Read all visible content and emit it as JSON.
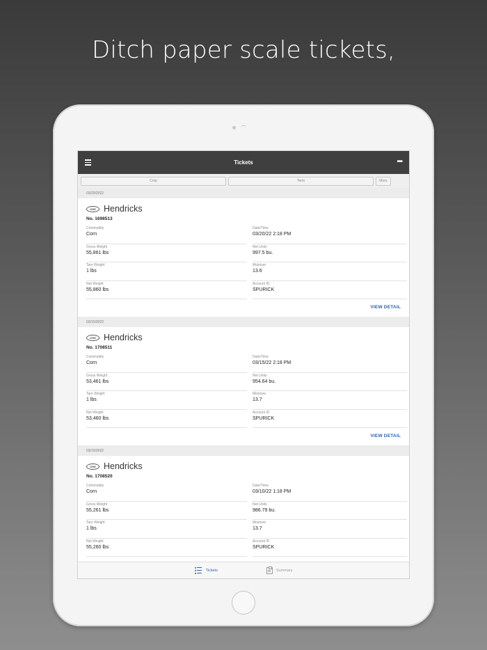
{
  "headline": "Ditch paper scale tickets,",
  "app": {
    "title": "Tickets",
    "more_label": "•••"
  },
  "filters": {
    "crop": "Crop",
    "term": "Term",
    "more": "More"
  },
  "labels": {
    "commodity": "Commodity",
    "datetime": "Date/Time",
    "gross_weight": "Gross Weight",
    "net_units": "Net Units",
    "tare_weight": "Tare Weight",
    "moisture": "Moisture",
    "net_weight": "Net Weight",
    "account_id": "Account ID",
    "view_detail": "VIEW DETAIL"
  },
  "tickets": [
    {
      "date": "03/20/2022",
      "logo": "CHS",
      "location": "Hendricks",
      "number": "No. 1698513",
      "commodity": "Corn",
      "datetime": "03/20/22 2:18 PM",
      "gross_weight": "55,861 lbs",
      "net_units": "997.5 bu.",
      "tare_weight": "1 lbs",
      "moisture": "13.6",
      "net_weight": "55,860 lbs",
      "account_id": "SPURICK"
    },
    {
      "date": "03/15/2022",
      "logo": "CHS",
      "location": "Hendricks",
      "number": "No. 1708511",
      "commodity": "Corn",
      "datetime": "03/15/22 2:18 PM",
      "gross_weight": "53,461 lbs",
      "net_units": "954.64 bu.",
      "tare_weight": "1 lbs",
      "moisture": "13.7",
      "net_weight": "53,460 lbs",
      "account_id": "SPURICK"
    },
    {
      "date": "03/10/2022",
      "logo": "CHS",
      "location": "Hendricks",
      "number": "No. 1708520",
      "commodity": "Corn",
      "datetime": "03/10/22 1:18 PM",
      "gross_weight": "55,261 lbs",
      "net_units": "986.79 bu.",
      "tare_weight": "1 lbs",
      "moisture": "13.7",
      "net_weight": "55,260 lbs",
      "account_id": "SPURICK"
    }
  ],
  "tabs": [
    {
      "label": "Tickets",
      "icon": "list-icon",
      "active": true
    },
    {
      "label": "Summary",
      "icon": "clipboard-icon",
      "active": false
    }
  ],
  "colors": {
    "header_bg": "#3f3f3f",
    "accent": "#2b5fb3"
  }
}
